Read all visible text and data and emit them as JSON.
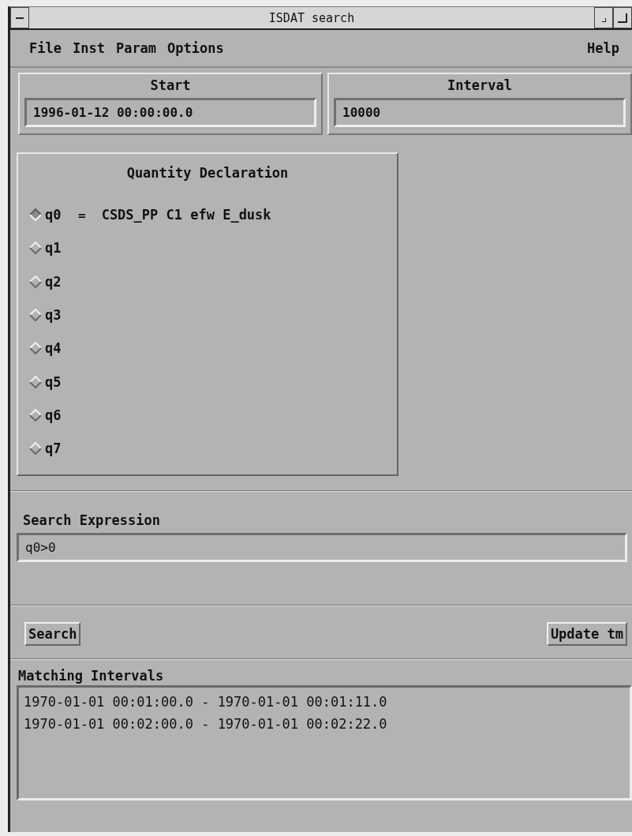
{
  "window": {
    "title": "ISDAT search"
  },
  "menu": {
    "left": [
      "File",
      "Inst",
      "Param",
      "Options"
    ],
    "right": [
      "Help"
    ]
  },
  "time": {
    "start_label": "Start",
    "start_value": "1996-01-12 00:00:00.0",
    "interval_label": "Interval",
    "interval_value": "10000"
  },
  "quantities": {
    "title": "Quantity Declaration",
    "items": [
      {
        "label": "q0",
        "selected": true,
        "operator": "=",
        "value": "CSDS_PP C1 efw E_dusk"
      },
      {
        "label": "q1",
        "selected": false
      },
      {
        "label": "q2",
        "selected": false
      },
      {
        "label": "q3",
        "selected": false
      },
      {
        "label": "q4",
        "selected": false
      },
      {
        "label": "q5",
        "selected": false
      },
      {
        "label": "q6",
        "selected": false
      },
      {
        "label": "q7",
        "selected": false
      }
    ]
  },
  "search": {
    "label": "Search Expression",
    "value": "q0>0"
  },
  "buttons": {
    "search": "Search",
    "update": "Update tm"
  },
  "results": {
    "label": "Matching Intervals",
    "rows": [
      "1970-01-01 00:01:00.0 - 1970-01-01 00:01:11.0",
      "1970-01-01 00:02:00.0 - 1970-01-01 00:02:22.0"
    ]
  }
}
